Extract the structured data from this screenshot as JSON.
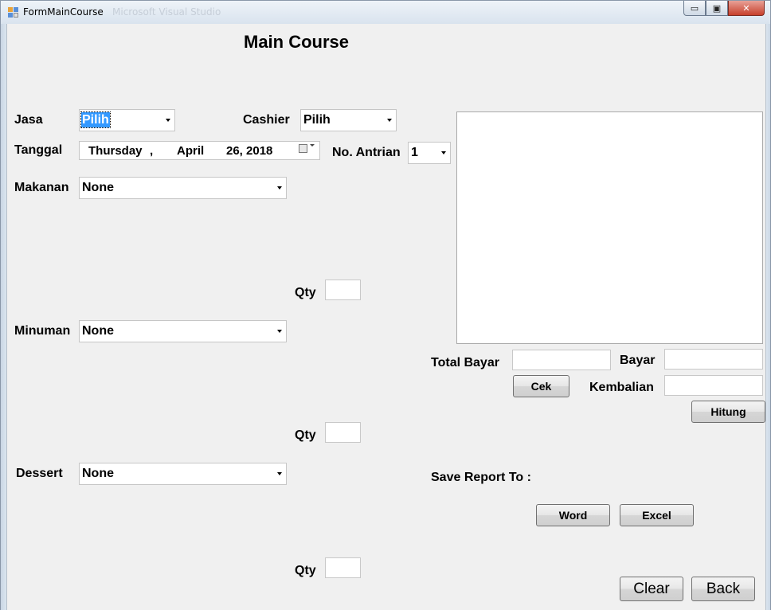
{
  "window": {
    "title": "FormMainCourse",
    "background_title": "Microsoft Visual Studio",
    "minimize_glyph": "▭",
    "maximize_glyph": "▣",
    "close_glyph": "✕"
  },
  "form": {
    "heading": "Main Course",
    "jasa": {
      "label": "Jasa",
      "value": "Pilih"
    },
    "cashier": {
      "label": "Cashier",
      "value": "Pilih"
    },
    "tanggal": {
      "label": "Tanggal",
      "day": "Thursday",
      "sep": ",",
      "month": "April",
      "date_year": "26, 2018"
    },
    "antrian": {
      "label": "No. Antrian",
      "value": "1"
    },
    "makanan": {
      "label": "Makanan",
      "value": "None",
      "qty_label": "Qty"
    },
    "minuman": {
      "label": "Minuman",
      "value": "None",
      "qty_label": "Qty"
    },
    "dessert": {
      "label": "Dessert",
      "value": "None",
      "qty_label": "Qty"
    }
  },
  "payment": {
    "total_label": "Total Bayar",
    "bayar_label": "Bayar",
    "kembalian_label": "Kembalian",
    "cek_button": "Cek",
    "hitung_button": "Hitung"
  },
  "report": {
    "label": "Save Report To :",
    "word_button": "Word",
    "excel_button": "Excel"
  },
  "footer": {
    "clear_button": "Clear",
    "back_button": "Back"
  },
  "colors": {
    "selection": "#3399ff",
    "form_background": "#f0f0f0"
  }
}
